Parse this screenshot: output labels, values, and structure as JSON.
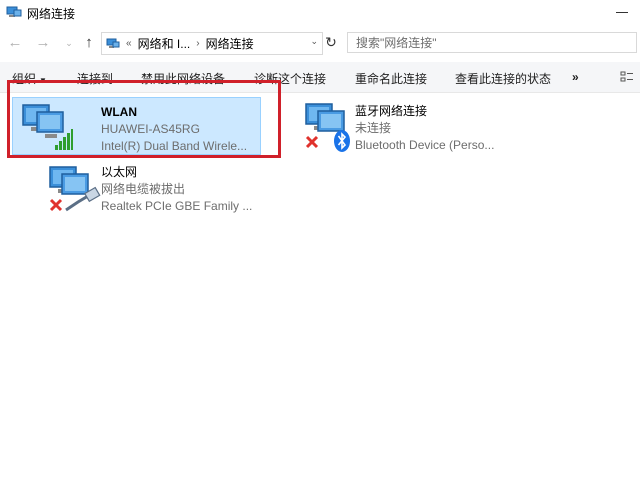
{
  "window": {
    "title": "网络连接"
  },
  "address": {
    "recent_overflow": "«",
    "crumb_1": "网络和 I...",
    "crumb_separator": "›",
    "crumb_2": "网络连接",
    "search_placeholder": "搜索\"网络连接\""
  },
  "commands": {
    "organize": "组织",
    "connect_to": "连接到",
    "disable": "禁用此网络设备",
    "diagnose": "诊断这个连接",
    "rename": "重命名此连接",
    "view_status": "查看此连接的状态",
    "more": "»"
  },
  "connections": [
    {
      "name": "WLAN",
      "status": "HUAWEI-AS45RG",
      "device": "Intel(R) Dual Band Wirele...",
      "selected": true,
      "icon": "wireless-signal-icon"
    },
    {
      "name": "蓝牙网络连接",
      "status": "未连接",
      "device": "Bluetooth Device (Perso...",
      "selected": false,
      "icon": "bluetooth-icon"
    },
    {
      "name": "以太网",
      "status": "网络电缆被拔出",
      "device": "Realtek PCIe GBE Family ...",
      "selected": false,
      "icon": "ethernet-cable-icon"
    }
  ],
  "colors": {
    "selection_fill": "#cce8ff",
    "highlight_border": "#d0202a",
    "error_x": "#e0322d",
    "bluetooth_blue": "#1a73e8",
    "signal_green": "#2f9e2f"
  }
}
